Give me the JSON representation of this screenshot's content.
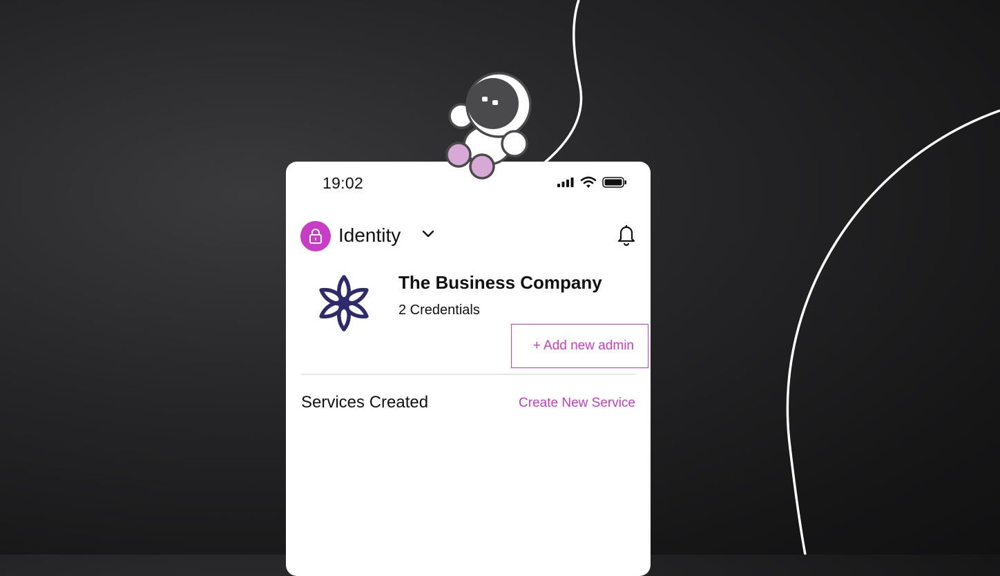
{
  "status_bar": {
    "time": "19:02",
    "icons": [
      "cellular-signal-icon",
      "wifi-icon",
      "battery-icon"
    ]
  },
  "header": {
    "badge_icon": "lock-icon",
    "title": "Identity",
    "dropdown_icon": "chevron-down-icon",
    "notification_icon": "bell-icon"
  },
  "company": {
    "logo_icon": "flower-logo-icon",
    "name": "The Business Company",
    "credentials": "2 Credentials",
    "add_admin_label": "+ Add new admin"
  },
  "services": {
    "title": "Services Created",
    "create_label": "Create New Service"
  },
  "colors": {
    "accent": "#c93cc6",
    "logo": "#2e2a6b",
    "background": "#1c1c1d",
    "astronaut_hands": "#d9a9d6"
  }
}
